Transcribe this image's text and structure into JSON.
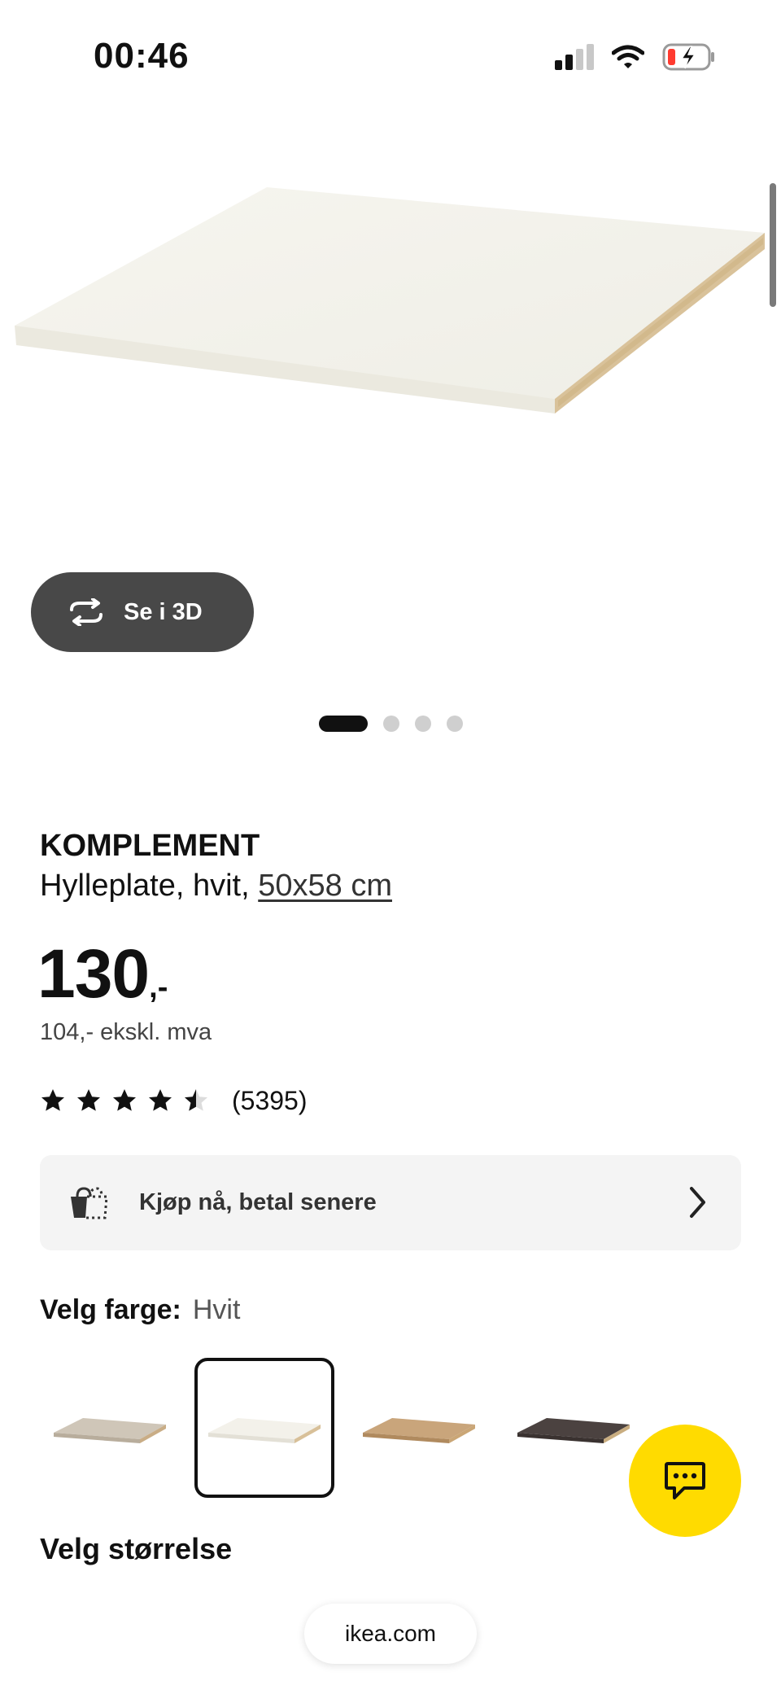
{
  "status_bar": {
    "time": "00:46",
    "icons": [
      "cellular-signal-icon",
      "wifi-icon",
      "battery-charging-icon"
    ],
    "battery_level": 0.15
  },
  "product_gallery": {
    "button_3d_label": "Se i 3D",
    "image_count": 4,
    "active_index": 0
  },
  "product": {
    "name": "KOMPLEMENT",
    "description": "Hylleplate, hvit,",
    "size_link": "50x58 cm",
    "price_main": "130",
    "price_suffix": ",-",
    "price_ex_vat": "104,- ekskl. mva",
    "rating_value": 4.5,
    "rating_max": 5,
    "rating_count": "(5395)"
  },
  "buy_now": {
    "label": "Kjøp nå, betal senere",
    "icon": "shopping-bag-icon",
    "chevron": "chevron-right-icon"
  },
  "color_picker": {
    "label": "Velg farge:",
    "selected_value": "Hvit",
    "options": [
      {
        "name": "beige",
        "color": "#cfc6b8"
      },
      {
        "name": "hvit",
        "color": "#f3f1ea",
        "selected": true
      },
      {
        "name": "eik",
        "color": "#c9a57b"
      },
      {
        "name": "mørk brun",
        "color": "#4b4240"
      }
    ]
  },
  "size_picker": {
    "label": "Velg størrelse"
  },
  "chat": {
    "icon": "chat-icon",
    "color": "#ffdb00"
  },
  "browser": {
    "url": "ikea.com"
  }
}
